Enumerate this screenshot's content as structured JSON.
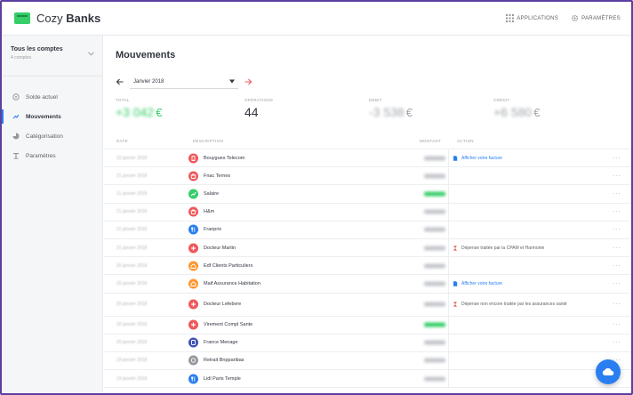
{
  "app": {
    "brand_prefix": "Cozy",
    "brand_name": "Banks",
    "applications_label": "APPLICATIONS",
    "settings_label": "PARAMÈTRES"
  },
  "sidebar": {
    "account_selector": {
      "title": "Tous les comptes",
      "subtitle": "4 comptes"
    },
    "items": [
      {
        "label": "Solde actuel",
        "icon": "balance-icon",
        "active": false
      },
      {
        "label": "Mouvements",
        "icon": "movements-icon",
        "active": true
      },
      {
        "label": "Catégorisation",
        "icon": "categorization-icon",
        "active": false
      },
      {
        "label": "Paramètres",
        "icon": "settings-icon",
        "active": false
      }
    ]
  },
  "main": {
    "title": "Mouvements",
    "month": "Janvier 2018",
    "kpis": {
      "total": {
        "label": "TOTAL",
        "value": "+3 042",
        "unit": "€"
      },
      "operations": {
        "label": "OPÉRATIONS",
        "value": "44"
      },
      "spent": {
        "label": "DÉBIT",
        "value": "-3 538",
        "unit": "€"
      },
      "credit": {
        "label": "CRÉDIT",
        "value": "+6 580",
        "unit": "€"
      }
    },
    "columns": {
      "date": "DATE",
      "description": "DESCRIPTION",
      "amount": "MONTANT",
      "action": "ACTION"
    },
    "rows": [
      {
        "date": "22 janvier 2018",
        "description": "Bouygues Telecom",
        "category_color": "#f05759",
        "icon": "telecom-icon",
        "amount_color": "#c3c6cb",
        "action": "Afficher votre facture",
        "action_type": "bill"
      },
      {
        "date": "21 janvier 2018",
        "description": "Fnac Ternes",
        "category_color": "#f05759",
        "icon": "shopping-icon",
        "amount_color": "#c3c6cb",
        "action": "",
        "action_type": ""
      },
      {
        "date": "21 janvier 2018",
        "description": "Salaire",
        "category_color": "#35ce68",
        "icon": "income-icon",
        "amount_color": "#35ce68",
        "action": "",
        "action_type": ""
      },
      {
        "date": "21 janvier 2018",
        "description": "H&m",
        "category_color": "#f05759",
        "icon": "shopping-icon",
        "amount_color": "#c3c6cb",
        "action": "",
        "action_type": ""
      },
      {
        "date": "21 janvier 2018",
        "description": "Franprix",
        "category_color": "#297ef2",
        "icon": "food-icon",
        "amount_color": "#c3c6cb",
        "action": "",
        "action_type": ""
      },
      {
        "date": "21 janvier 2018",
        "description": "Docteur Martin",
        "category_color": "#f05759",
        "icon": "health-icon",
        "amount_color": "#c3c6cb",
        "action": "Dépense traitée par la CPAM et Harmonie",
        "action_type": "health"
      },
      {
        "date": "20 janvier 2018",
        "description": "Edf Clients Particuliers",
        "category_color": "#ff962f",
        "icon": "home-icon",
        "amount_color": "#c3c6cb",
        "action": "",
        "action_type": ""
      },
      {
        "date": "20 janvier 2018",
        "description": "Maif Assurance Habitation",
        "category_color": "#ff962f",
        "icon": "home-icon",
        "amount_color": "#c3c6cb",
        "action": "Afficher votre facture",
        "action_type": "bill"
      },
      {
        "date": "20 janvier 2018",
        "description": "Docteur Lefebvre",
        "category_color": "#f05759",
        "icon": "health-icon",
        "amount_color": "#c3c6cb",
        "action": "Dépense non encore traitée par les assurances santé",
        "action_type": "health",
        "tall": true
      },
      {
        "date": "20 janvier 2018",
        "description": "Virement Compl Sante",
        "category_color": "#f05759",
        "icon": "health-icon",
        "amount_color": "#35ce68",
        "action": "",
        "action_type": ""
      },
      {
        "date": "20 janvier 2018",
        "description": "France Menage",
        "category_color": "#3f51b5",
        "icon": "services-icon",
        "amount_color": "#c3c6cb",
        "action": "",
        "action_type": ""
      },
      {
        "date": "19 janvier 2018",
        "description": "Retrait Bnpparibas",
        "category_color": "#95999d",
        "icon": "withdrawal-icon",
        "amount_color": "#c3c6cb",
        "action": "",
        "action_type": ""
      },
      {
        "date": "19 janvier 2018",
        "description": "Lidl Paris Temple",
        "category_color": "#297ef2",
        "icon": "food-icon",
        "amount_color": "#c3c6cb",
        "action": "",
        "action_type": ""
      }
    ]
  },
  "colors": {
    "accent": "#297ef2",
    "positive": "#35ce68",
    "expense_red": "#f05759",
    "frame": "#5b3fa0"
  }
}
